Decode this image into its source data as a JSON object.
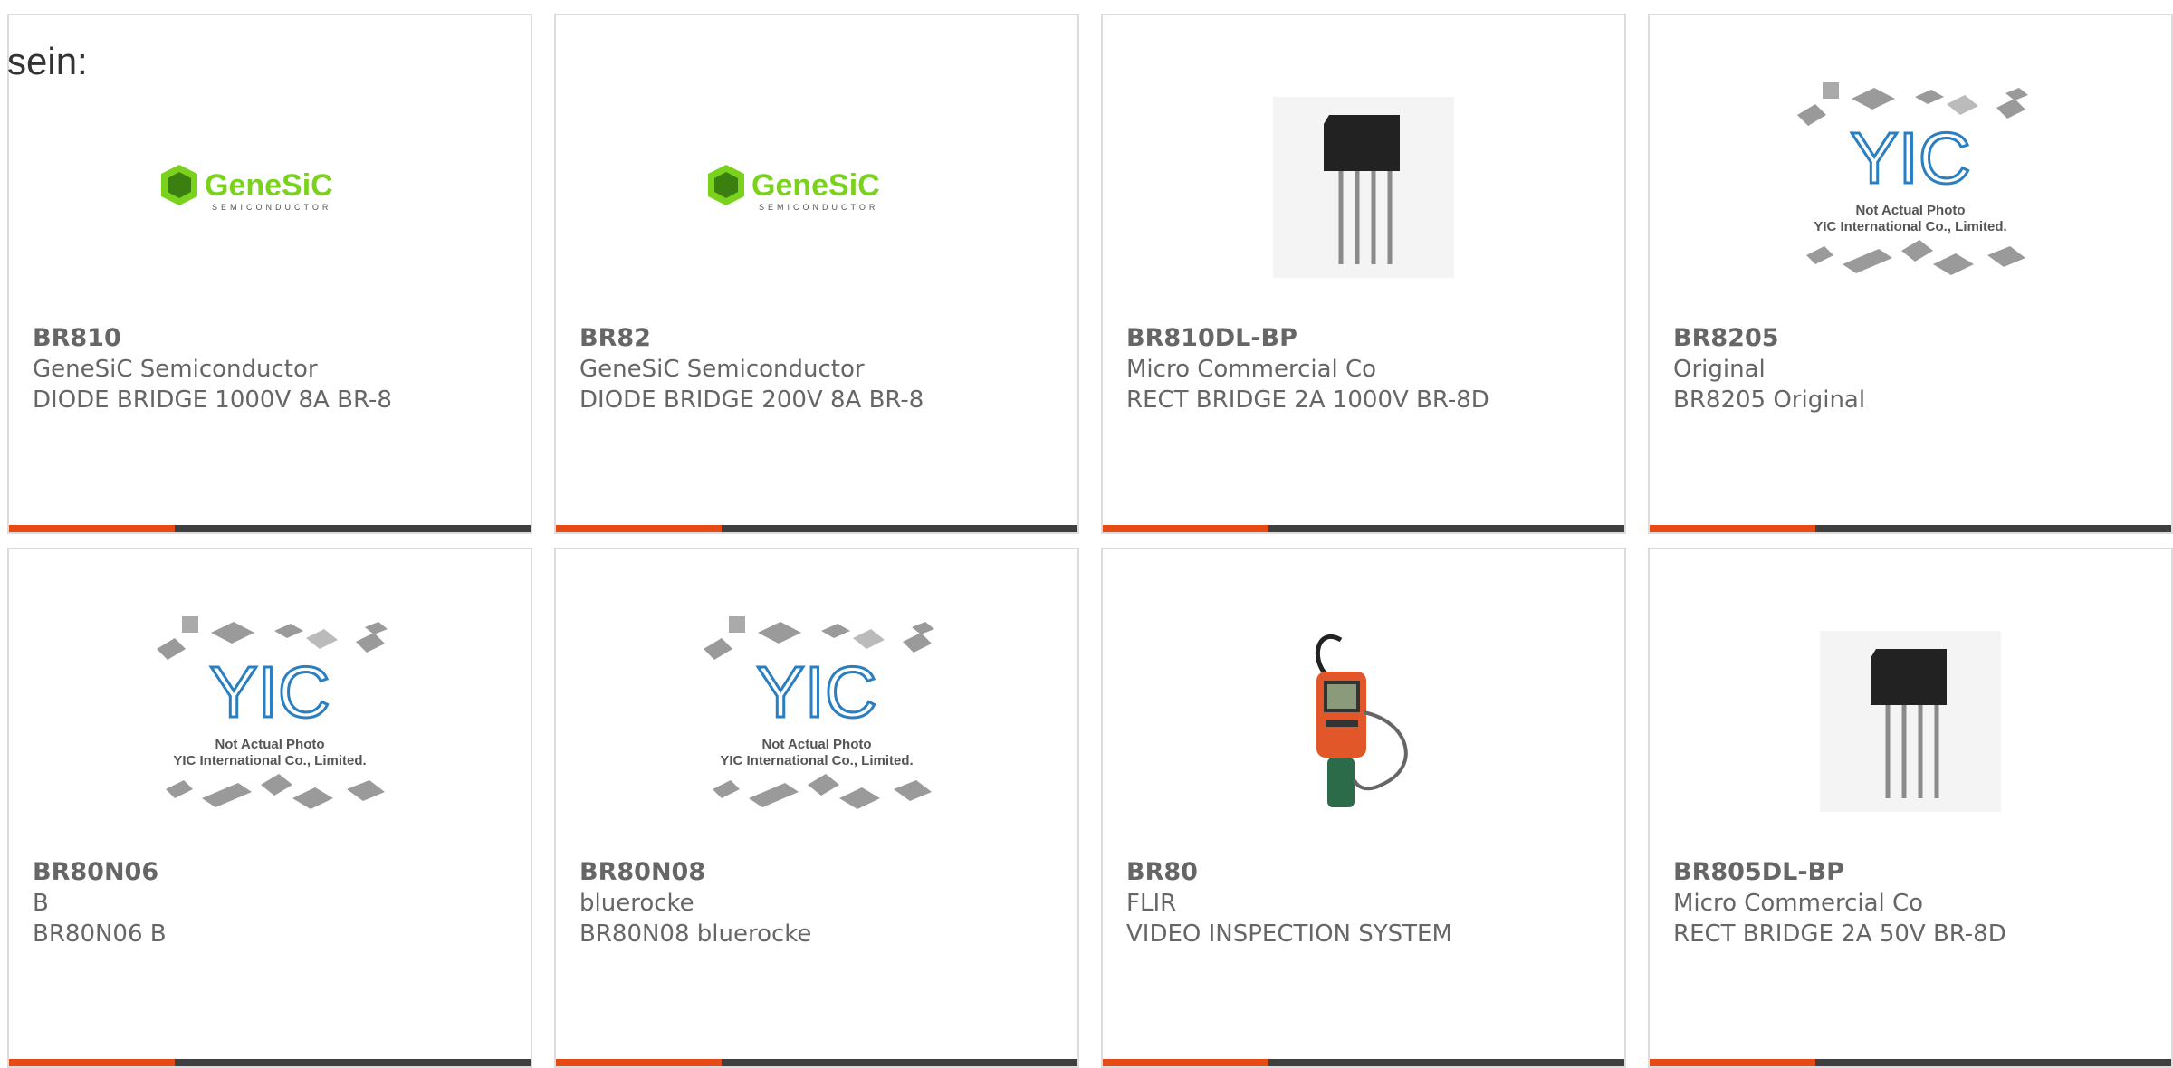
{
  "intro_text": "sein:",
  "colors": {
    "accent": "#e84a15",
    "bar": "#3f3f3f",
    "border": "#dcdcdc",
    "text": "#666666"
  },
  "products": [
    {
      "part": "BR810",
      "manufacturer": "GeneSiC Semiconductor",
      "description": "DIODE BRIDGE 1000V 8A BR-8",
      "image": "genesic-logo"
    },
    {
      "part": "BR82",
      "manufacturer": "GeneSiC Semiconductor",
      "description": "DIODE BRIDGE 200V 8A BR-8",
      "image": "genesic-logo"
    },
    {
      "part": "BR810DL-BP",
      "manufacturer": "Micro Commercial Co",
      "description": "RECT BRIDGE 2A 1000V BR-8D",
      "image": "bridge-rectifier-photo"
    },
    {
      "part": "BR8205",
      "manufacturer": "Original",
      "description": "BR8205 Original",
      "image": "yic-placeholder"
    },
    {
      "part": "BR80N06",
      "manufacturer": "B",
      "description": "BR80N06 B",
      "image": "yic-placeholder"
    },
    {
      "part": "BR80N08",
      "manufacturer": "bluerocke",
      "description": "BR80N08 bluerocke",
      "image": "yic-placeholder"
    },
    {
      "part": "BR80",
      "manufacturer": "FLIR",
      "description": "VIDEO INSPECTION SYSTEM",
      "image": "inspection-camera-photo"
    },
    {
      "part": "BR805DL-BP",
      "manufacturer": "Micro Commercial Co",
      "description": "RECT BRIDGE 2A 50V BR-8D",
      "image": "bridge-rectifier-photo"
    }
  ],
  "logo": {
    "brand": "GeneSiC",
    "sub": "SEMICONDUCTOR"
  },
  "yic": {
    "mark": "YIC",
    "line1": "Not Actual Photo",
    "line2": "YIC International Co., Limited."
  }
}
